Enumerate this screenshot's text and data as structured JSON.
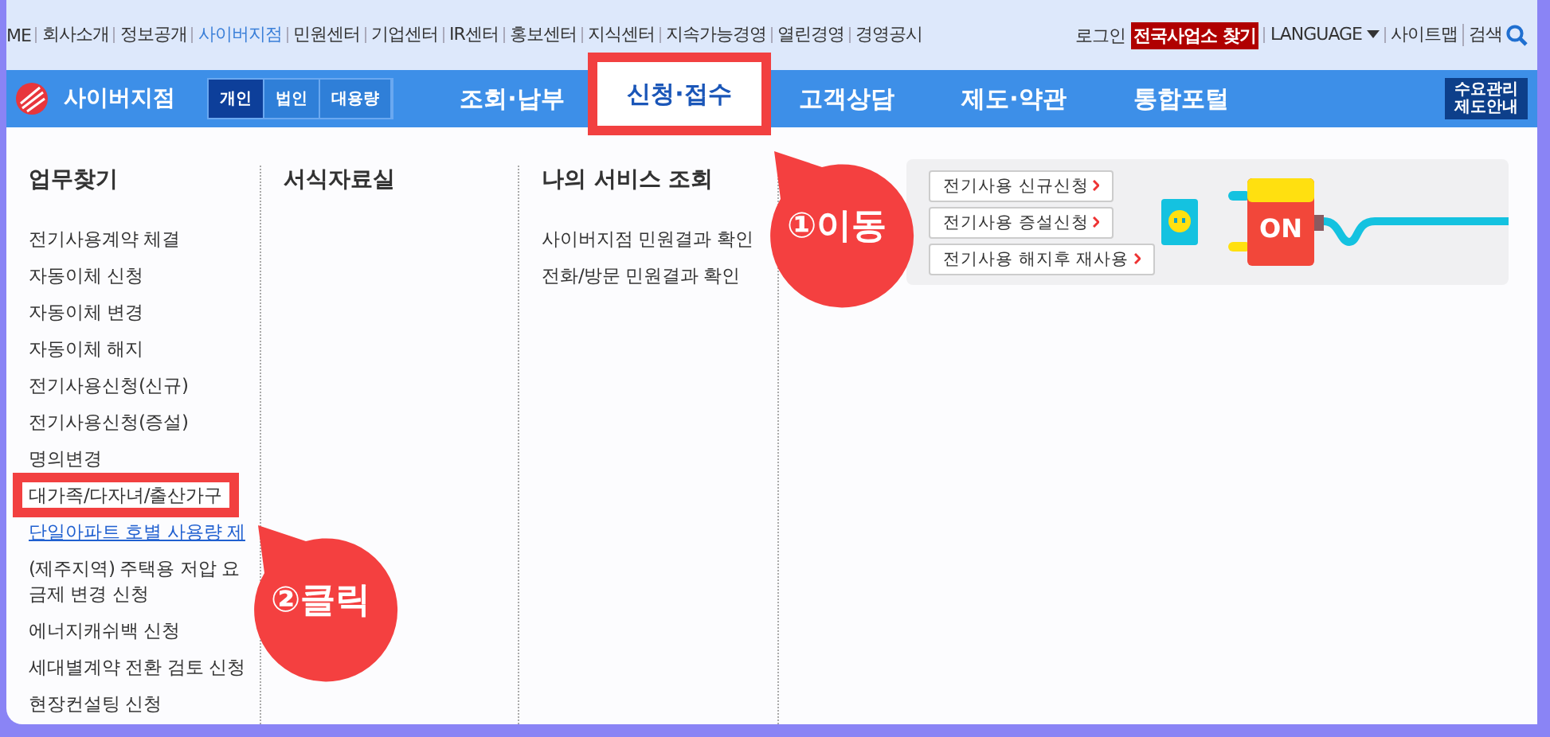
{
  "util_links": [
    {
      "label": "ME",
      "selected": false
    },
    {
      "label": "회사소개",
      "selected": false
    },
    {
      "label": "정보공개",
      "selected": false
    },
    {
      "label": "사이버지점",
      "selected": true
    },
    {
      "label": "민원센터",
      "selected": false
    },
    {
      "label": "기업센터",
      "selected": false
    },
    {
      "label": "IR센터",
      "selected": false
    },
    {
      "label": "홍보센터",
      "selected": false
    },
    {
      "label": "지식센터",
      "selected": false
    },
    {
      "label": "지속가능경영",
      "selected": false
    },
    {
      "label": "열린경영",
      "selected": false
    },
    {
      "label": "경영공시",
      "selected": false
    }
  ],
  "util_right": [
    {
      "label": "로그인",
      "kind": "link"
    },
    {
      "label": "전국사업소 찾기",
      "kind": "highlight"
    },
    {
      "label": "LANGUAGE",
      "kind": "dropdown"
    },
    {
      "label": "사이트맵",
      "kind": "link"
    },
    {
      "label": "검색",
      "kind": "search"
    }
  ],
  "nav": {
    "brand": "사이버지점",
    "segments": [
      {
        "label": "개인",
        "selected": true
      },
      {
        "label": "법인",
        "selected": false
      },
      {
        "label": "대용량",
        "selected": false
      }
    ],
    "tabs": [
      {
        "label": "조회·납부",
        "selected": false,
        "highlighted": false
      },
      {
        "label": "신청·접수",
        "selected": true,
        "highlighted": true
      },
      {
        "label": "고객상담",
        "selected": false,
        "highlighted": false
      },
      {
        "label": "제도·약관",
        "selected": false,
        "highlighted": false
      },
      {
        "label": "통합포털",
        "selected": false,
        "highlighted": false
      }
    ],
    "guide_button": [
      "수요관리",
      "제도안내"
    ]
  },
  "menu_columns": [
    {
      "title": "업무찾기",
      "items": [
        {
          "label": "전기사용계약 체결",
          "highlighted": false
        },
        {
          "label": "자동이체 신청",
          "highlighted": false
        },
        {
          "label": "자동이체 변경",
          "highlighted": false
        },
        {
          "label": "자동이체 해지",
          "highlighted": false
        },
        {
          "label": "전기사용신청(신규)",
          "highlighted": false
        },
        {
          "label": "전기사용신청(증설)",
          "highlighted": false
        },
        {
          "label": "명의변경",
          "highlighted": false
        },
        {
          "label": "대가족/다자녀/출산가구",
          "highlighted": true
        },
        {
          "label": "단일아파트 호별 사용량 제",
          "highlighted": false,
          "kind": "link"
        },
        {
          "label": "(제주지역) 주택용 저압 요금제 변경 신청",
          "highlighted": false
        },
        {
          "label": "에너지캐쉬백 신청",
          "highlighted": false
        },
        {
          "label": "세대별계약 전환 검토 신청",
          "highlighted": false
        },
        {
          "label": "현장컨설팅 신청",
          "highlighted": false
        }
      ]
    },
    {
      "title": "서식자료실"
    },
    {
      "title": "나의 서비스 조회",
      "items": [
        {
          "label": "사이버지점 민원결과 확인",
          "highlighted": false
        },
        {
          "label": "전화/방문 민원결과 확인",
          "highlighted": false
        }
      ]
    }
  ],
  "promo": {
    "buttons": [
      "전기사용 신규신청",
      "전기사용 증설신청",
      "전기사용 해지후 재사용"
    ],
    "plug_label": "ON"
  },
  "annotations": [
    {
      "label": "①이동"
    },
    {
      "label": "②클릭"
    }
  ]
}
